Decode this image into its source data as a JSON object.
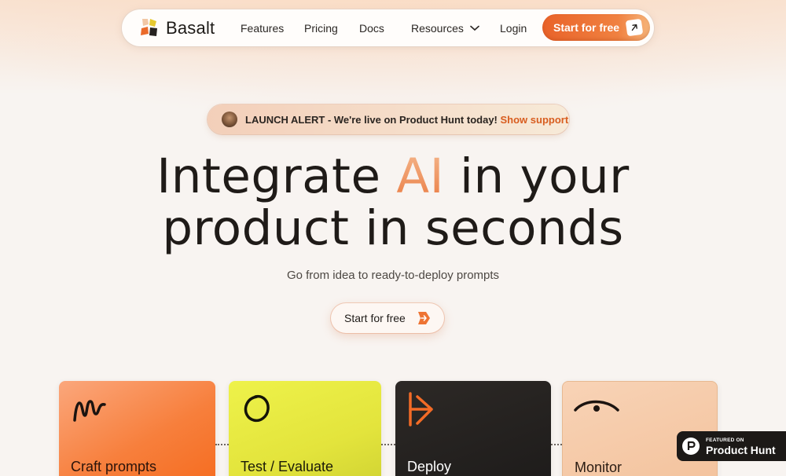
{
  "brand": {
    "name": "Basalt"
  },
  "nav": {
    "features": "Features",
    "pricing": "Pricing",
    "docs": "Docs",
    "resources": "Resources",
    "login": "Login",
    "cta": "Start for free"
  },
  "alert": {
    "text": "LAUNCH ALERT - We're live on Product Hunt today!",
    "link": "Show support"
  },
  "hero": {
    "title_line1_before": "Integrate ",
    "title_highlight": "AI",
    "title_line1_after": " in your",
    "title_line2": "product in seconds",
    "subtitle": "Go from idea to ready-to-deploy prompts",
    "cta": "Start for free"
  },
  "cards": [
    {
      "label": "Craft prompts",
      "icon": "squiggle-icon"
    },
    {
      "label": "Test / Evaluate",
      "icon": "circle-scribble-icon"
    },
    {
      "label": "Deploy",
      "icon": "deploy-arrow-icon"
    },
    {
      "label": "Monitor",
      "icon": "eye-icon"
    }
  ],
  "product_hunt": {
    "small": "FEATURED ON",
    "big": "Product Hunt"
  },
  "colors": {
    "accent": "#e9632a",
    "card_craft": "#f77f3c",
    "card_test": "#e3e43c",
    "card_deploy": "#1d1b1a",
    "card_monitor": "#f3c29c"
  }
}
